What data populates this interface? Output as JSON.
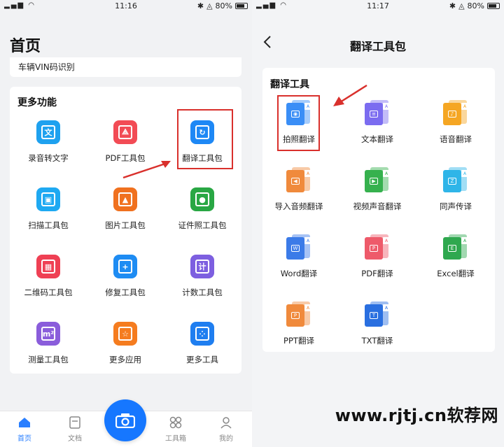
{
  "left": {
    "status": {
      "time": "11:16",
      "battery": "80%"
    },
    "title": "首页",
    "top_card_text": "车辆VIN码识别",
    "more": {
      "title": "更多功能",
      "items": [
        {
          "label": "录音转文字",
          "glyph": "文",
          "color": "#1ea1ef",
          "icon": "speech-to-text-icon"
        },
        {
          "label": "PDF工具包",
          "glyph": "⟁",
          "color": "#f24b55",
          "icon": "pdf-icon"
        },
        {
          "label": "翻译工具包",
          "glyph": "↻",
          "color": "#1e88f5",
          "icon": "translate-icon"
        },
        {
          "label": "扫描工具包",
          "glyph": "▣",
          "color": "#1ea9f2",
          "icon": "scan-icon"
        },
        {
          "label": "图片工具包",
          "glyph": "▲",
          "color": "#f0711f",
          "icon": "image-icon"
        },
        {
          "label": "证件照工具包",
          "glyph": "●",
          "color": "#29a744",
          "icon": "id-photo-icon"
        },
        {
          "label": "二维码工具包",
          "glyph": "▦",
          "color": "#ef4054",
          "icon": "qrcode-icon"
        },
        {
          "label": "修复工具包",
          "glyph": "+",
          "color": "#1e8cf3",
          "icon": "repair-icon"
        },
        {
          "label": "计数工具包",
          "glyph": "计",
          "color": "#7d5fe0",
          "icon": "count-icon"
        },
        {
          "label": "测量工具包",
          "glyph": "m²",
          "color": "#8a5ddb",
          "icon": "measure-icon"
        },
        {
          "label": "更多应用",
          "glyph": "☆",
          "color": "#f57c1f",
          "icon": "more-apps-icon"
        },
        {
          "label": "更多工具",
          "glyph": "⁘",
          "color": "#1f7ef0",
          "icon": "more-tools-icon"
        }
      ]
    },
    "tabs": [
      {
        "label": "首页",
        "icon": "home-icon",
        "glyph": "⌂"
      },
      {
        "label": "文档",
        "icon": "document-icon",
        "glyph": "▤"
      },
      {
        "label": "工具箱",
        "icon": "toolbox-icon",
        "glyph": "⊞"
      },
      {
        "label": "我的",
        "icon": "profile-icon",
        "glyph": "◯"
      }
    ]
  },
  "right": {
    "status": {
      "time": "11:17",
      "battery": "80%"
    },
    "nav_title": "翻译工具包",
    "card_title": "翻译工具",
    "items": [
      {
        "label": "拍照翻译",
        "color": "#3a8ef6",
        "sym": "◉",
        "icon": "photo-translate-icon"
      },
      {
        "label": "文本翻译",
        "color": "#7b6cf0",
        "sym": "≡",
        "icon": "text-translate-icon"
      },
      {
        "label": "语音翻译",
        "color": "#f5a623",
        "sym": "♪",
        "icon": "voice-translate-icon"
      },
      {
        "label": "导入音频翻译",
        "color": "#f08a3c",
        "sym": "◀",
        "icon": "audio-import-icon"
      },
      {
        "label": "视频声音翻译",
        "color": "#36b14e",
        "sym": "▶",
        "icon": "video-audio-icon"
      },
      {
        "label": "同声传译",
        "color": "#2fb5e8",
        "sym": "Z",
        "icon": "simultaneous-icon"
      },
      {
        "label": "Word翻译",
        "color": "#3b7be8",
        "sym": "W",
        "icon": "word-icon"
      },
      {
        "label": "PDF翻译",
        "color": "#ee5a6a",
        "sym": "P",
        "icon": "pdf-translate-icon"
      },
      {
        "label": "Excel翻译",
        "color": "#2fa84f",
        "sym": "E",
        "icon": "excel-icon"
      },
      {
        "label": "PPT翻译",
        "color": "#f08a3c",
        "sym": "P",
        "icon": "ppt-icon"
      },
      {
        "label": "TXT翻译",
        "color": "#2a6fe0",
        "sym": "T",
        "icon": "txt-icon"
      }
    ]
  },
  "watermark": "www.rjtj.cn软荐网"
}
